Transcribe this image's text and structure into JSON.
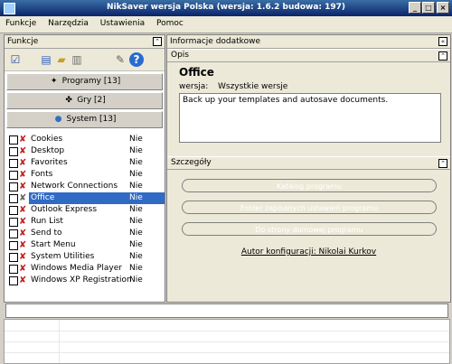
{
  "window": {
    "title": "NikSaver wersja Polska (wersja: 1.6.2 budowa: 197)"
  },
  "menu": [
    "Funkcje",
    "Narzędzia",
    "Ustawienia",
    "Pomoc"
  ],
  "left_panel": {
    "title": "Funkcje",
    "categories": [
      {
        "label": "Programy [13]",
        "icon": "programs-icon"
      },
      {
        "label": "Gry [2]",
        "icon": "games-icon"
      },
      {
        "label": "System [13]",
        "icon": "system-icon"
      }
    ],
    "items": [
      {
        "label": "Cookies",
        "value": "Nie"
      },
      {
        "label": "Desktop",
        "value": "Nie"
      },
      {
        "label": "Favorites",
        "value": "Nie"
      },
      {
        "label": "Fonts",
        "value": "Nie"
      },
      {
        "label": "Network Connections",
        "value": "Nie"
      },
      {
        "label": "Office",
        "value": "Nie",
        "selected": true
      },
      {
        "label": "Outlook Express",
        "value": "Nie"
      },
      {
        "label": "Run List",
        "value": "Nie"
      },
      {
        "label": "Send to",
        "value": "Nie"
      },
      {
        "label": "Start Menu",
        "value": "Nie"
      },
      {
        "label": "System Utilities",
        "value": "Nie"
      },
      {
        "label": "Windows Media Player",
        "value": "Nie"
      },
      {
        "label": "Windows XP Registration",
        "value": "Nie"
      }
    ]
  },
  "right_panel": {
    "title": "Informacje dodatkowe",
    "opis": {
      "header": "Opis",
      "name": "Office",
      "version_label": "wersja:",
      "version_value": "Wszystkie wersje",
      "description": "Back up your templates and autosave documents."
    },
    "szczegoly": {
      "header": "Szczegóły",
      "buttons": [
        "Katalog programu",
        "Folder zapisanych ustawień programu",
        "Do strony domowej programu"
      ],
      "author": "Autor konfiguracji: Nikolai Kurkov"
    }
  },
  "colors": {
    "title_bar": "#0a246a",
    "selection": "#316ac5",
    "x_mark": "#c21e1e"
  }
}
